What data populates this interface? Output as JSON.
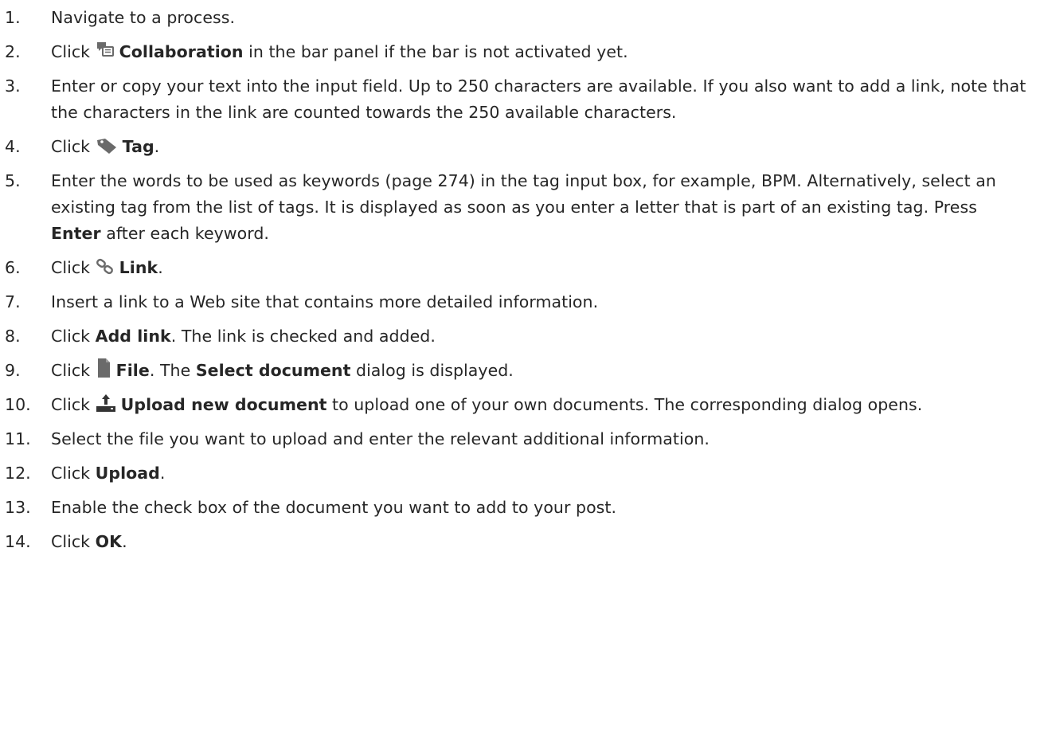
{
  "steps": [
    {
      "num": "1.",
      "t1": "Navigate to a process."
    },
    {
      "num": "2.",
      "pre": "Click ",
      "icon": "collaboration-icon",
      "label": "Collaboration",
      "post": " in the bar panel if the bar is not activated yet."
    },
    {
      "num": "3.",
      "t1": "Enter or copy your text into the input field. Up to 250 characters are available. If you also want to add a link, note that the characters in the link are counted towards the 250 available characters."
    },
    {
      "num": "4.",
      "pre": "Click ",
      "icon": "tag-icon",
      "label": "Tag",
      "post": "."
    },
    {
      "num": "5.",
      "t1": "Enter the words to be used as keywords (page 274) in the tag input box, for example, BPM. Alternatively, select an existing tag from the list of tags. It is displayed as soon as you enter a letter that is part of an existing tag. Press ",
      "label": "Enter",
      "post": " after each keyword."
    },
    {
      "num": "6.",
      "pre": "Click ",
      "icon": "link-icon",
      "label": "Link",
      "post": "."
    },
    {
      "num": "7.",
      "t1": "Insert a link to a Web site that contains more detailed information."
    },
    {
      "num": "8.",
      "pre": "Click ",
      "label": "Add link",
      "post": ". The link is checked and added."
    },
    {
      "num": "9.",
      "pre": "Click ",
      "icon": "file-icon",
      "label": "File",
      "mid": ". The ",
      "label2": "Select document",
      "post": " dialog is displayed."
    },
    {
      "num": "10.",
      "pre": "Click ",
      "icon": "upload-icon",
      "label": "Upload new document",
      "post": " to upload one of your own documents. The corresponding dialog opens."
    },
    {
      "num": "11.",
      "t1": "Select the file you want to upload and enter the relevant additional information."
    },
    {
      "num": "12.",
      "pre": "Click ",
      "label": "Upload",
      "post": "."
    },
    {
      "num": "13.",
      "t1": "Enable the check box of the document you want to add to your post."
    },
    {
      "num": "14.",
      "pre": "Click ",
      "label": "OK",
      "post": "."
    }
  ]
}
